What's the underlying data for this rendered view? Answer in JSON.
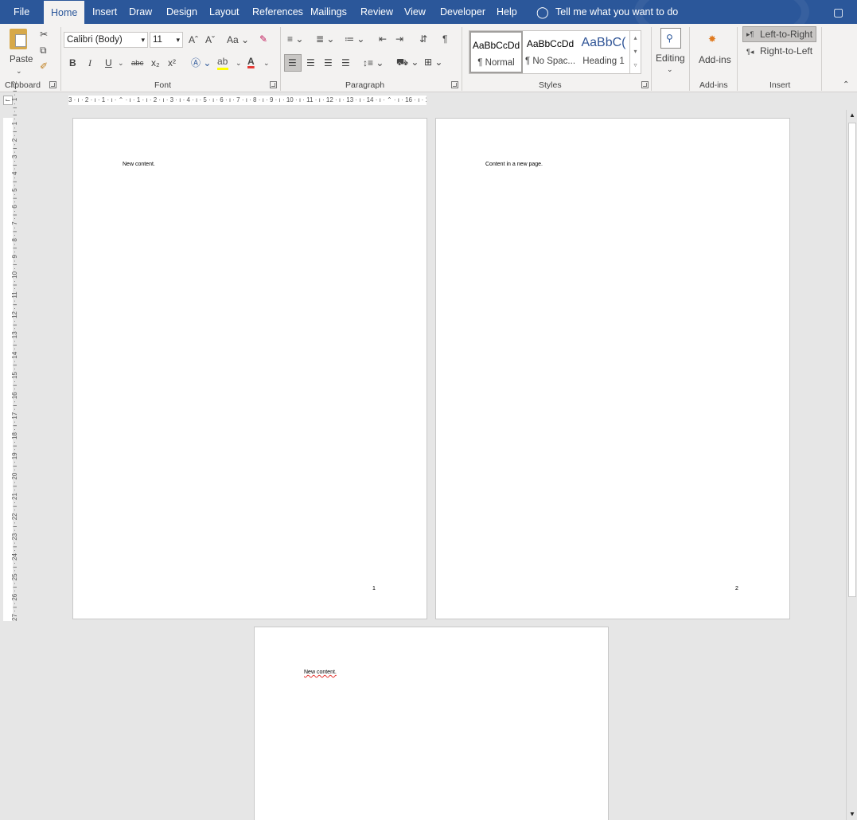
{
  "menu": {
    "tabs": [
      "File",
      "Home",
      "Insert",
      "Draw",
      "Design",
      "Layout",
      "References",
      "Mailings",
      "Review",
      "View",
      "Developer",
      "Help"
    ],
    "tell_me": "Tell me what you want to do"
  },
  "ribbon": {
    "clipboard": {
      "paste": "Paste",
      "group_label": "Clipboard"
    },
    "font": {
      "font_name": "Calibri (Body)",
      "font_size": "11",
      "case_label": "Aa",
      "bold": "B",
      "italic": "I",
      "underline": "U",
      "strike": "abc",
      "subscript": "x₂",
      "superscript": "x²",
      "group_label": "Font"
    },
    "paragraph": {
      "group_label": "Paragraph",
      "show_marks": "¶"
    },
    "styles": {
      "items": [
        {
          "sample": "AaBbCcDd",
          "name": "¶ Normal"
        },
        {
          "sample": "AaBbCcDd",
          "name": "¶ No Spac..."
        },
        {
          "sample": "AaBbC(",
          "name": "Heading 1"
        }
      ],
      "group_label": "Styles"
    },
    "editing": {
      "label": "Editing"
    },
    "addins": {
      "label": "Add-ins",
      "group_label": "Add-ins"
    },
    "insert": {
      "ltr": "Left-to-Right",
      "rtl": "Right-to-Left",
      "group_label": "Insert"
    }
  },
  "ruler": {
    "horizontal": "3 · ı · 2 · ı · 1 · ı · ⌃ · ı · 1 · ı · 2 · ı · 3 · ı · 4 · ı · 5 · ı · 6 · ı · 7 · ı · 8 · ı · 9 · ı · 10 · ı · 11 · ı · 12 · ı · 13 · ı · 14 · ı · ⌃ · ı · 16 · ı · 17 · ı ·",
    "vertical": "27 · ı · 26 · ı · 25 · ı · 24 · ı · 23 · ı · 22 · ı · 21 · ı · 20 · ı · 19 · ı · 18 · ı · 17 · ı · 16 · ı · 15 · ı · 14 · ı · 13 · ı · 12 · ı · 11 · ı · 10 · ı · 9 · ı · 8 · ı · 7 · ı · 6 · ı · 5 · ı · 4 · ı · 3 · ı · 2 · ı · 1 · ı · ı · 1 · ı · 2"
  },
  "document": {
    "pages": [
      {
        "text": "New content.",
        "number": "1"
      },
      {
        "text": "Content in a new page.",
        "number": "2"
      },
      {
        "text": "New content."
      }
    ]
  },
  "colors": {
    "title_bar": "#2b579a",
    "ribbon_bg": "#f3f2f1",
    "canvas_bg": "#e6e6e6"
  }
}
